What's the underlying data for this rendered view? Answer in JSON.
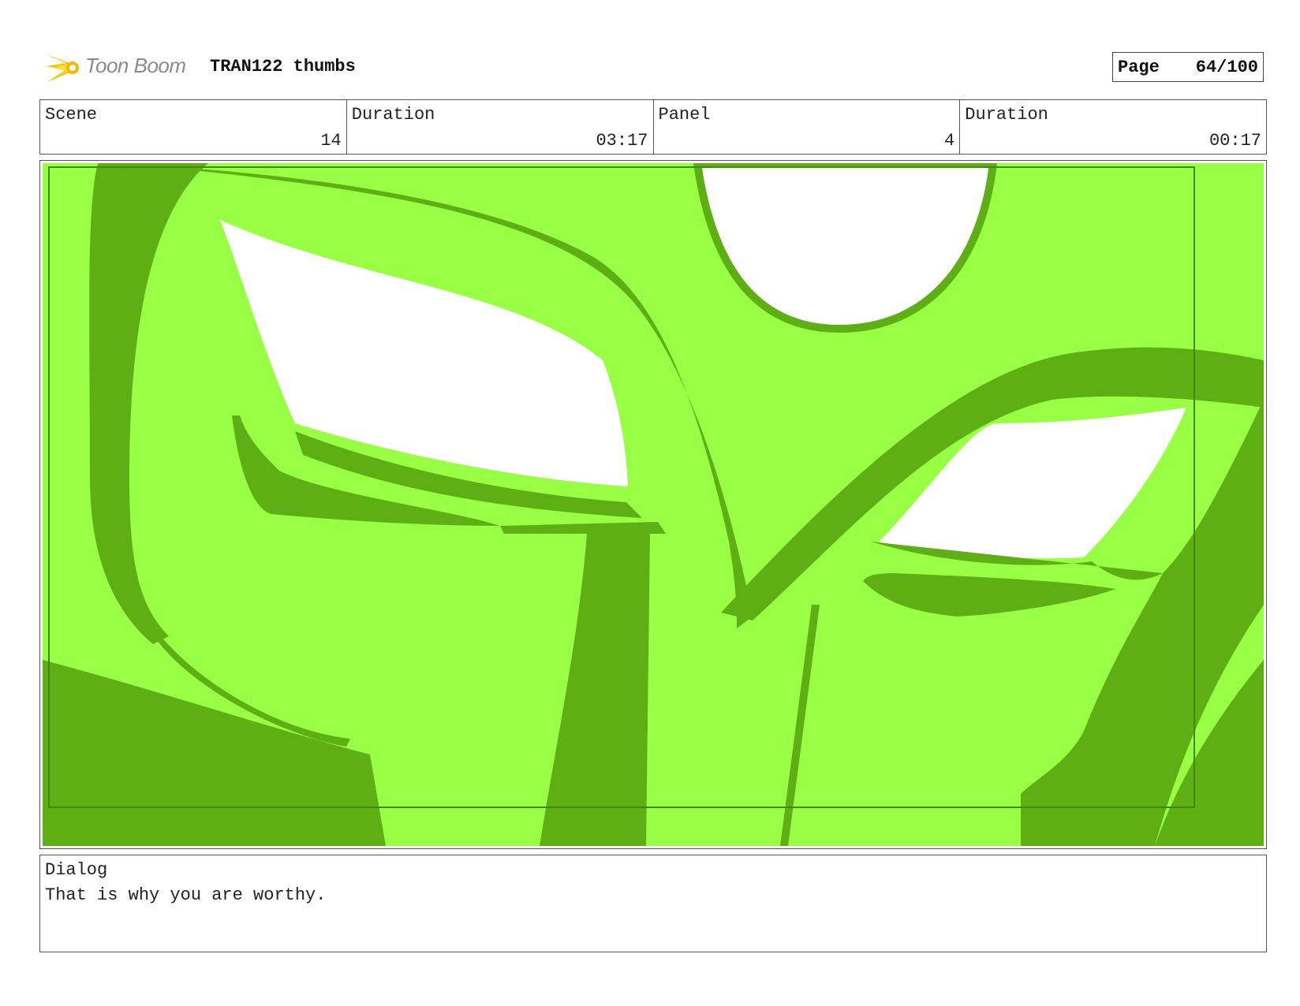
{
  "header": {
    "brand": "Toon Boom",
    "title": "TRAN122 thumbs",
    "page_label": "Page",
    "page_value": "64/100"
  },
  "info": {
    "scene_label": "Scene",
    "scene_value": "14",
    "scene_duration_label": "Duration",
    "scene_duration_value": "03:17",
    "panel_label": "Panel",
    "panel_value": "4",
    "panel_duration_label": "Duration",
    "panel_duration_value": "00:17"
  },
  "dialog": {
    "label": "Dialog",
    "text": "That is why you are worthy."
  },
  "colors": {
    "panel_light_green": "#99ff44",
    "panel_dark_green": "#5daf14",
    "logo_yellow": "#f5c400"
  },
  "icons": {
    "logo": "toon-boom-starburst-icon"
  }
}
